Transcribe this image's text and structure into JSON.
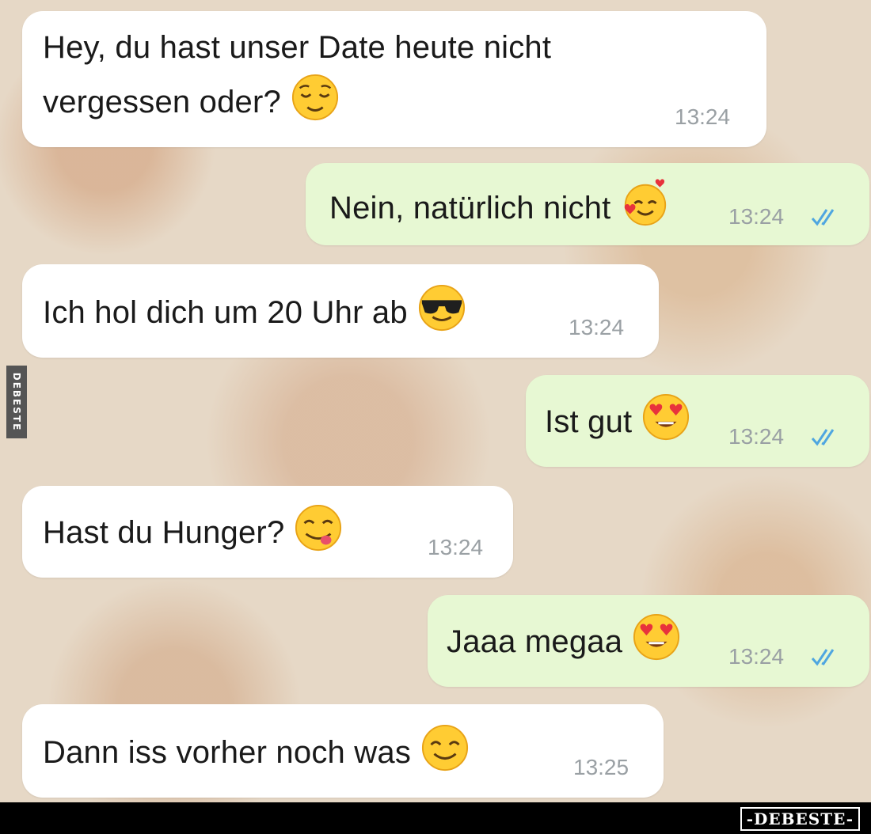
{
  "watermark_side": "DEBESTE",
  "watermark_brand": "-DEBESTE-",
  "messages": [
    {
      "direction": "incoming",
      "lines": [
        "Hey, du hast unser Date heute nicht",
        "vergessen oder?"
      ],
      "emoji": "relieved-face",
      "time": "13:24"
    },
    {
      "direction": "outgoing",
      "lines": [
        "Nein, natürlich nicht"
      ],
      "emoji": "smiling-face-with-hearts",
      "time": "13:24",
      "status": "read-double-check"
    },
    {
      "direction": "incoming",
      "lines": [
        "Ich hol dich um 20 Uhr ab"
      ],
      "emoji": "sunglasses-face",
      "time": "13:24"
    },
    {
      "direction": "outgoing",
      "lines": [
        "Ist gut"
      ],
      "emoji": "heart-eyes-face",
      "time": "13:24",
      "status": "read-double-check"
    },
    {
      "direction": "incoming",
      "lines": [
        "Hast du Hunger?"
      ],
      "emoji": "face-savoring-food",
      "time": "13:24"
    },
    {
      "direction": "outgoing",
      "lines": [
        "Jaaa megaa"
      ],
      "emoji": "heart-eyes-face",
      "time": "13:24",
      "status": "read-double-check"
    },
    {
      "direction": "incoming",
      "lines": [
        "Dann iss vorher noch was"
      ],
      "emoji": "smiling-face",
      "time": "13:25"
    }
  ],
  "colors": {
    "incoming_bubble": "#ffffff",
    "outgoing_bubble": "#e7f8d3",
    "read_ticks": "#4fa6e0",
    "time_text": "#9aa0a4"
  }
}
